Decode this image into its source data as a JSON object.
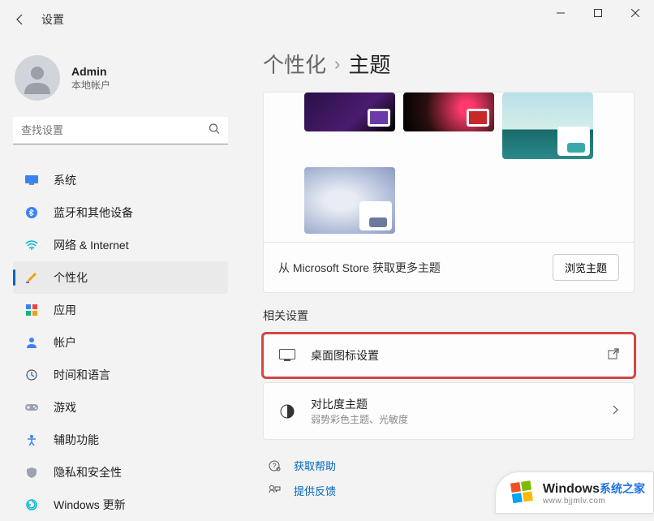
{
  "window": {
    "title": "设置"
  },
  "user": {
    "name": "Admin",
    "sub": "本地帐户"
  },
  "search": {
    "placeholder": "查找设置"
  },
  "nav": [
    {
      "label": "系统"
    },
    {
      "label": "蓝牙和其他设备"
    },
    {
      "label": "网络 & Internet"
    },
    {
      "label": "个性化"
    },
    {
      "label": "应用"
    },
    {
      "label": "帐户"
    },
    {
      "label": "时间和语言"
    },
    {
      "label": "游戏"
    },
    {
      "label": "辅助功能"
    },
    {
      "label": "隐私和安全性"
    },
    {
      "label": "Windows 更新"
    }
  ],
  "breadcrumb": {
    "parent": "个性化",
    "current": "主题"
  },
  "store": {
    "text": "从 Microsoft Store 获取更多主题",
    "button": "浏览主题"
  },
  "section_related": "相关设置",
  "settings": {
    "desktop_icons": {
      "title": "桌面图标设置"
    },
    "contrast": {
      "title": "对比度主题",
      "desc": "弱势彩色主题、光敏度"
    }
  },
  "help": {
    "get": "获取帮助",
    "feedback": "提供反馈"
  },
  "watermark": {
    "brand": "Windows",
    "suffix": "系统之家",
    "url": "www.bjjmlv.com"
  }
}
